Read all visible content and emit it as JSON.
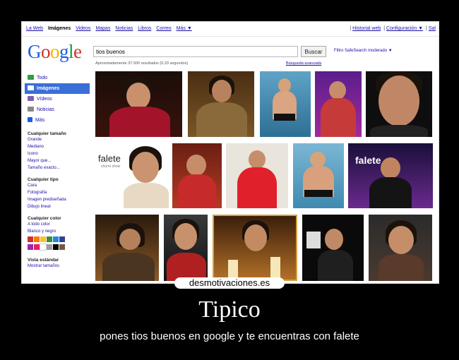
{
  "topnav": {
    "items": [
      "La Web",
      "Imágenes",
      "Videos",
      "Mapas",
      "Noticias",
      "Libros",
      "Correo",
      "Más ▼"
    ],
    "active": "Imágenes",
    "right": [
      "Historial web",
      "Configuración ▼",
      "Sal"
    ]
  },
  "logo": [
    "G",
    "o",
    "o",
    "g",
    "l",
    "e"
  ],
  "search": {
    "query": "tios buenos",
    "button": "Buscar",
    "safesearch": "Filtro SafeSearch moderado ▼"
  },
  "results_text": "Aproximadamente 37.500 resultados (0,33 segundos)",
  "advanced_link": "Búsqueda avanzada",
  "sidebar": {
    "items": [
      {
        "label": "Todo",
        "icon": "all-icon",
        "color": "#2f9e44"
      },
      {
        "label": "Imágenes",
        "icon": "images-icon",
        "color": "#ffffff"
      },
      {
        "label": "Vídeos",
        "icon": "video-icon",
        "color": "#7b61b5"
      },
      {
        "label": "Noticias",
        "icon": "news-icon",
        "color": "#888888"
      },
      {
        "label": "Más",
        "icon": "more-icon",
        "color": "#1a5ce5"
      }
    ],
    "size_head": "Cualquier tamaño",
    "sizes": [
      "Grande",
      "Mediano",
      "Icono",
      "Mayor que...",
      "Tamaño exacto..."
    ],
    "type_head": "Cualquier tipo",
    "types": [
      "Cara",
      "Fotografía",
      "Imagen prediseñada",
      "Dibujo lineal"
    ],
    "color_head": "Cualquier color",
    "colors_links": [
      "A todo color",
      "Blanco y negro"
    ],
    "swatches": [
      "#d32f2f",
      "#f57c00",
      "#fbc02d",
      "#388e3c",
      "#1e88e5",
      "#303f9f",
      "#9c27b0",
      "#e91e63",
      "#ffffff",
      "#9e9e9e",
      "#000000",
      "#795548"
    ],
    "view_head": "Vista estándar",
    "view_link": "Mostrar tamaños"
  },
  "thumbs": {
    "falete_label": "falete",
    "falete_sub": "chorro show",
    "falete2_label": "falete"
  },
  "brand": "desmotivaciones.es",
  "title": "Tipico",
  "caption": "pones tios buenos en google y te encuentras con falete"
}
